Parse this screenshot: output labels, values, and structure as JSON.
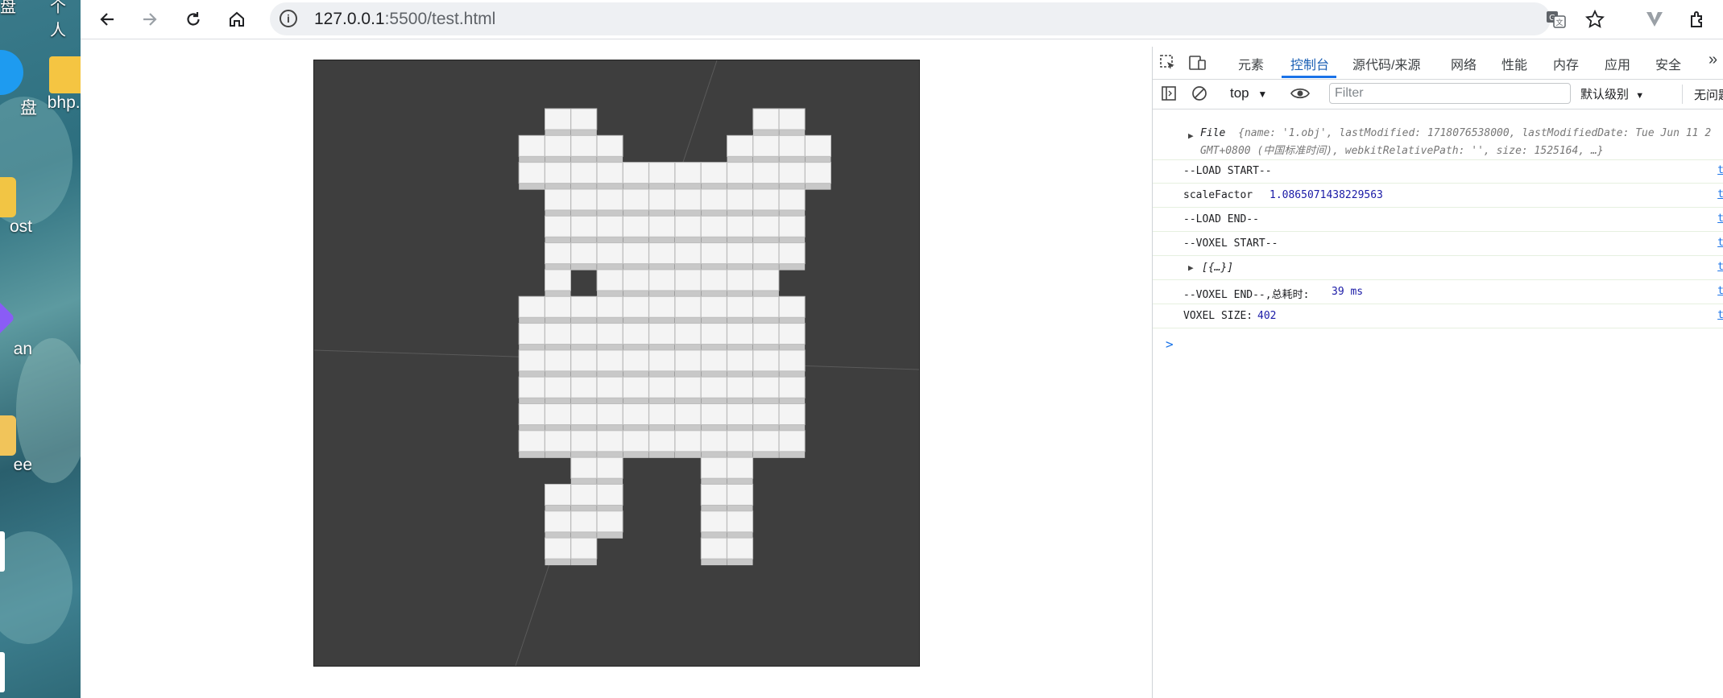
{
  "desktop": {
    "icons": [
      {
        "label": "盘"
      },
      {
        "label": "bhp..."
      },
      {
        "label": "ost"
      },
      {
        "label": "an"
      },
      {
        "label": "ee"
      }
    ],
    "top_labels": [
      "盘",
      "个人"
    ]
  },
  "browser": {
    "url_host": "127.0.0.1",
    "url_rest": ":5500/test.html",
    "icons": [
      "back-icon",
      "forward-icon",
      "reload-icon",
      "home-icon",
      "info-icon",
      "translate-icon",
      "bookmark-star-icon",
      "vivaldi-icon",
      "extensions-icon"
    ]
  },
  "devtools": {
    "tabs": [
      "元素",
      "控制台",
      "源代码/来源",
      "网络",
      "性能",
      "内存",
      "应用",
      "安全"
    ],
    "active_tab": "控制台",
    "more": "»",
    "context": "top",
    "filter_placeholder": "Filter",
    "levels": "默认级别",
    "issues": "无问题",
    "console": {
      "file_line1_prefix": "File",
      "file_line1_body": "{name: '1.obj', lastModified: 1718076538000, lastModifiedDate: Tue Jun 11 2",
      "file_line2": "GMT+0800 (中国标准时间), webkitRelativePath: '', size: 1525164,  …}",
      "load_start": "--LOAD START--",
      "scale_label": "scaleFactor",
      "scale_value": "1.0865071438229563",
      "load_end": "--LOAD END--",
      "voxel_start": "--VOXEL START--",
      "array_preview": "[{…}]",
      "voxel_end_label": "--VOXEL END--,总耗时:",
      "voxel_end_value": "39 ms",
      "voxel_size_label": "VOXEL SIZE:",
      "voxel_size_value": "402",
      "source_link": "t",
      "prompt": ">"
    }
  },
  "colors": {
    "canvas_bg": "#3e3e3e",
    "voxel_top": "#f4f4f4",
    "voxel_front": "#c8c8c8",
    "accent": "#1a73e8"
  }
}
